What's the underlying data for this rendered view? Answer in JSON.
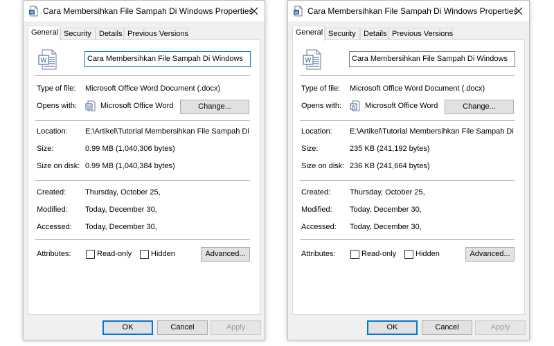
{
  "dialogs": [
    {
      "title": "Cara Membersihkan File Sampah Di Windows Properties",
      "tabs": [
        "General",
        "Security",
        "Details",
        "Previous Versions"
      ],
      "file_name": "Cara Membersihkan File Sampah Di Windows",
      "type_label": "Type of file:",
      "type_value": "Microsoft Office Word Document (.docx)",
      "opens_label": "Opens with:",
      "opens_value": "Microsoft Office Word",
      "change_button": "Change...",
      "location_label": "Location:",
      "location_value": "E:\\Artikel\\Tutorial Membersihkan File Sampah Di Wi",
      "size_label": "Size:",
      "size_value": "0.99 MB (1,040,306 bytes)",
      "size_on_disk_label": "Size on disk:",
      "size_on_disk_value": "0.99 MB (1,040,384 bytes)",
      "created_label": "Created:",
      "created_value": "Thursday, October 25,",
      "modified_label": "Modified:",
      "modified_value": "Today, December 30,",
      "accessed_label": "Accessed:",
      "accessed_value": "Today, December 30,",
      "attributes_label": "Attributes:",
      "readonly_label": "Read-only",
      "hidden_label": "Hidden",
      "advanced_button": "Advanced...",
      "ok_button": "OK",
      "cancel_button": "Cancel",
      "apply_button": "Apply"
    },
    {
      "title": "Cara Membersihkan File Sampah Di Windows Properties",
      "tabs": [
        "General",
        "Security",
        "Details",
        "Previous Versions"
      ],
      "file_name": "Cara Membersihkan File Sampah Di Windows",
      "type_label": "Type of file:",
      "type_value": "Microsoft Office Word Document (.docx)",
      "opens_label": "Opens with:",
      "opens_value": "Microsoft Office Word",
      "change_button": "Change...",
      "location_label": "Location:",
      "location_value": "E:\\Artikel\\Tutorial Membersihkan File Sampah Di Wi",
      "size_label": "Size:",
      "size_value": "235 KB (241,192 bytes)",
      "size_on_disk_label": "Size on disk:",
      "size_on_disk_value": "236 KB (241,664 bytes)",
      "created_label": "Created:",
      "created_value": "Thursday, October 25,",
      "modified_label": "Modified:",
      "modified_value": "Today, December 30,",
      "accessed_label": "Accessed:",
      "accessed_value": "Today, December 30,",
      "attributes_label": "Attributes:",
      "readonly_label": "Read-only",
      "hidden_label": "Hidden",
      "advanced_button": "Advanced...",
      "ok_button": "OK",
      "cancel_button": "Cancel",
      "apply_button": "Apply"
    }
  ],
  "colors": {
    "accent": "#0078d7",
    "window_bg": "#f0f0f0",
    "panel_bg": "#ffffff",
    "button_bg": "#e1e1e1"
  },
  "icons": {
    "title": "word-document-icon",
    "file": "word-document-icon",
    "app": "word-app-icon",
    "close": "close-icon"
  }
}
